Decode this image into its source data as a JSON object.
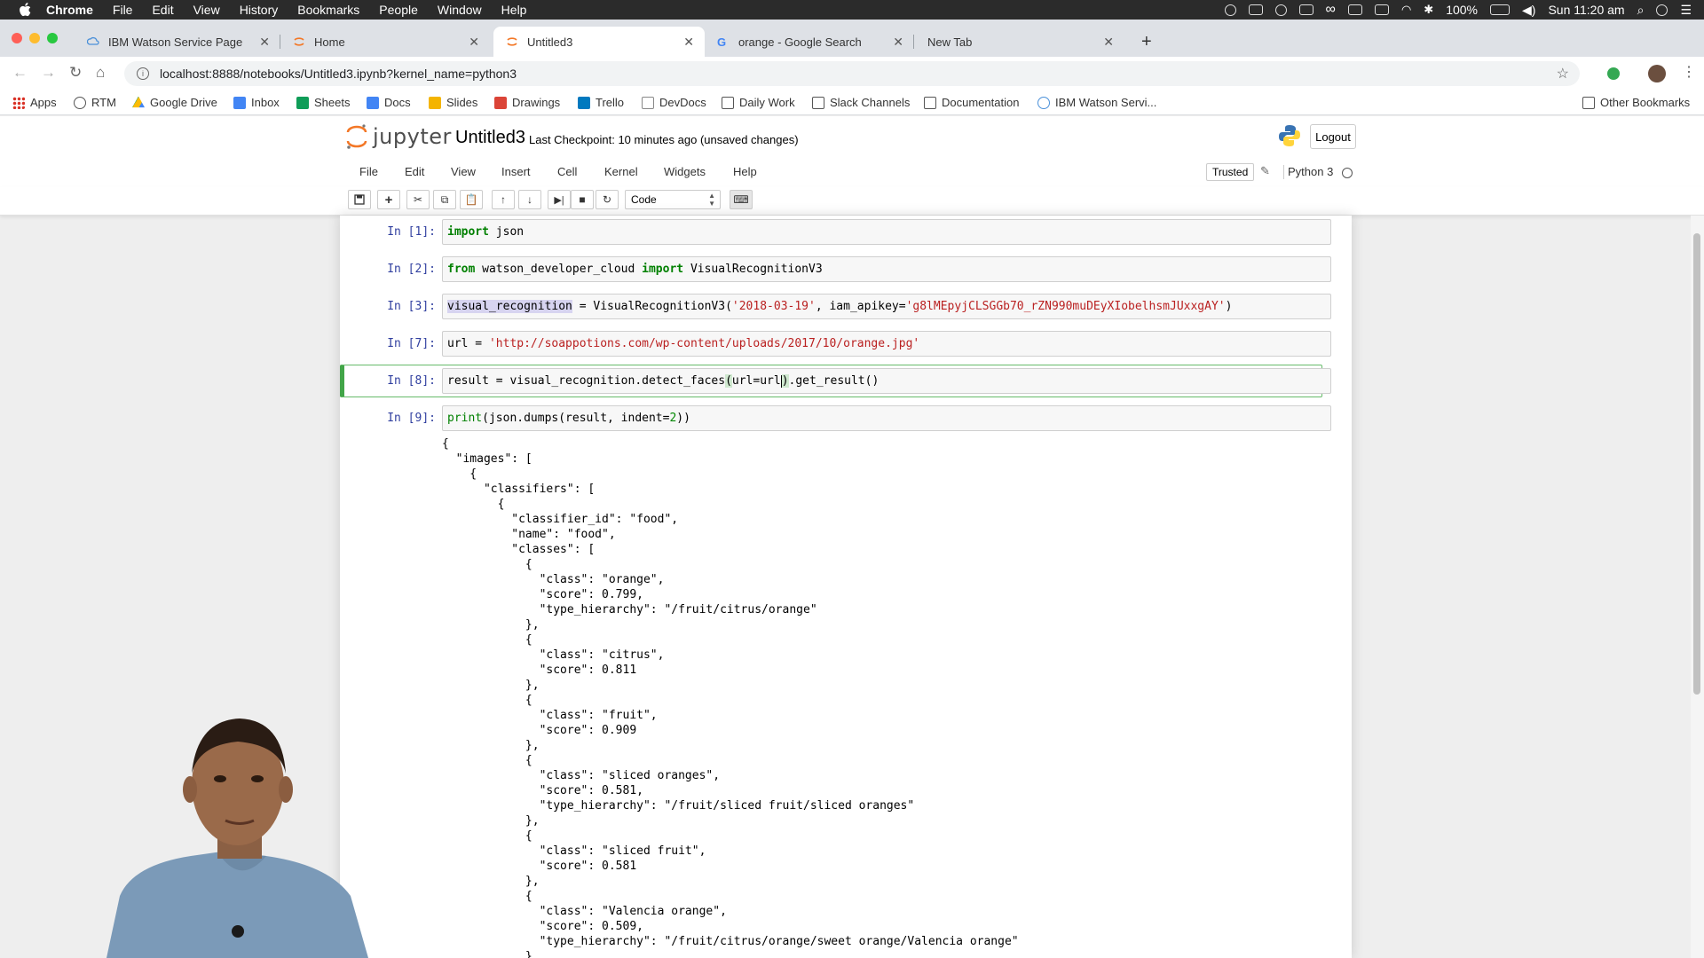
{
  "menubar": {
    "app": "Chrome",
    "items": [
      "File",
      "Edit",
      "View",
      "History",
      "Bookmarks",
      "People",
      "Window",
      "Help"
    ],
    "battery": "100%",
    "clock": "Sun 11:20 am"
  },
  "tabs": [
    {
      "title": "IBM Watson Service Page",
      "favicon": "ibm-cloud-icon"
    },
    {
      "title": "Home",
      "favicon": "jupyter-icon"
    },
    {
      "title": "Untitled3",
      "favicon": "jupyter-icon",
      "active": true
    },
    {
      "title": "orange - Google Search",
      "favicon": "google-icon"
    },
    {
      "title": "New Tab",
      "favicon": ""
    }
  ],
  "address": {
    "url": "localhost:8888/notebooks/Untitled3.ipynb?kernel_name=python3"
  },
  "bookmarks": [
    {
      "label": "Apps",
      "icon": "apps-grid-icon",
      "color": "#d93025"
    },
    {
      "label": "RTM",
      "icon": "rtm-icon",
      "color": "#555555"
    },
    {
      "label": "Google Drive",
      "icon": "drive-icon",
      "color": "#fbbc04"
    },
    {
      "label": "Inbox",
      "icon": "inbox-icon",
      "color": "#4285f4"
    },
    {
      "label": "Sheets",
      "icon": "sheets-icon",
      "color": "#0f9d58"
    },
    {
      "label": "Docs",
      "icon": "docs-icon",
      "color": "#4285f4"
    },
    {
      "label": "Slides",
      "icon": "slides-icon",
      "color": "#f4b400"
    },
    {
      "label": "Drawings",
      "icon": "drawings-icon",
      "color": "#db4437"
    },
    {
      "label": "Trello",
      "icon": "trello-icon",
      "color": "#0079bf"
    },
    {
      "label": "DevDocs",
      "icon": "devdocs-icon",
      "color": "#888888"
    },
    {
      "label": "Daily Work",
      "icon": "folder-icon",
      "color": "#555555"
    },
    {
      "label": "Slack Channels",
      "icon": "folder-icon",
      "color": "#555555"
    },
    {
      "label": "Documentation",
      "icon": "folder-icon",
      "color": "#555555"
    },
    {
      "label": "IBM Watson Servi...",
      "icon": "ibm-cloud-icon",
      "color": "#4a90d9"
    },
    {
      "label": "Other Bookmarks",
      "icon": "folder-icon",
      "color": "#555555"
    }
  ],
  "jupyter": {
    "logo_word": "jupyter",
    "notebook_title": "Untitled3",
    "checkpoint": "Last Checkpoint: 10 minutes ago (unsaved changes)",
    "logout": "Logout",
    "menu": [
      "File",
      "Edit",
      "View",
      "Insert",
      "Cell",
      "Kernel",
      "Widgets",
      "Help"
    ],
    "trusted": "Trusted",
    "kernel": "Python 3",
    "cell_type": "Code"
  },
  "cells": [
    {
      "prompt": "In [1]:"
    },
    {
      "prompt": "In [2]:"
    },
    {
      "prompt": "In [3]:",
      "apikey": "'g8lMEpyjCLSGGb70_rZN990muDEyXIobelhsmJUxxgAY'",
      "date": "'2018-03-19'"
    },
    {
      "prompt": "In [7]:",
      "url": "'http://soappotions.com/wp-content/uploads/2017/10/orange.jpg'"
    },
    {
      "prompt": "In [8]:"
    },
    {
      "prompt": "In [9]:",
      "indent": "2"
    }
  ],
  "output_text": "{\n  \"images\": [\n    {\n      \"classifiers\": [\n        {\n          \"classifier_id\": \"food\",\n          \"name\": \"food\",\n          \"classes\": [\n            {\n              \"class\": \"orange\",\n              \"score\": 0.799,\n              \"type_hierarchy\": \"/fruit/citrus/orange\"\n            },\n            {\n              \"class\": \"citrus\",\n              \"score\": 0.811\n            },\n            {\n              \"class\": \"fruit\",\n              \"score\": 0.909\n            },\n            {\n              \"class\": \"sliced oranges\",\n              \"score\": 0.581,\n              \"type_hierarchy\": \"/fruit/sliced fruit/sliced oranges\"\n            },\n            {\n              \"class\": \"sliced fruit\",\n              \"score\": 0.581\n            },\n            {\n              \"class\": \"Valencia orange\",\n              \"score\": 0.509,\n              \"type_hierarchy\": \"/fruit/citrus/orange/sweet orange/Valencia orange\"\n            },"
}
